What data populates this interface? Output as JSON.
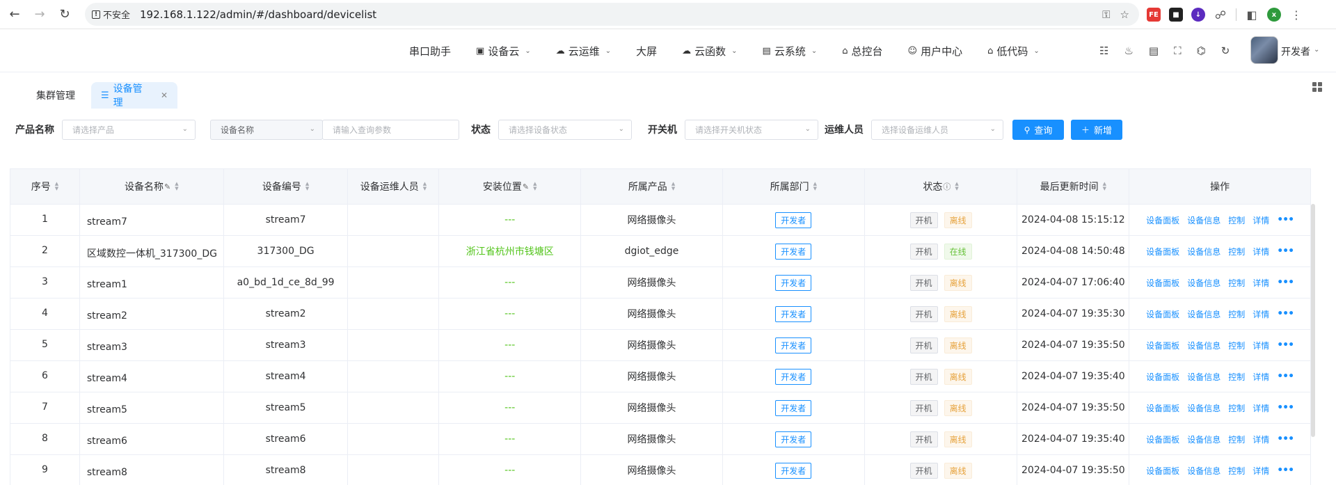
{
  "browser": {
    "insecure_label": "不安全",
    "url": "192.168.1.122/admin/#/dashboard/devicelist",
    "ext_fe_label": "FE",
    "profile_initial": "x"
  },
  "header": {
    "menu": [
      {
        "label": "串口助手",
        "icon": "",
        "caret": false
      },
      {
        "label": "设备云",
        "icon": "device-icon",
        "caret": true
      },
      {
        "label": "云运维",
        "icon": "cloud-icon",
        "caret": true
      },
      {
        "label": "大屏",
        "icon": "",
        "caret": false
      },
      {
        "label": "云函数",
        "icon": "cloud-function-icon",
        "caret": true
      },
      {
        "label": "云系统",
        "icon": "system-icon",
        "caret": true
      },
      {
        "label": "总控台",
        "icon": "home-icon",
        "caret": false
      },
      {
        "label": "用户中心",
        "icon": "user-icon",
        "caret": false
      },
      {
        "label": "低代码",
        "icon": "lowcode-icon",
        "caret": true
      }
    ],
    "user_name": "开发者"
  },
  "tabs": [
    {
      "label": "集群管理",
      "active": false
    },
    {
      "label": "设备管理",
      "active": true
    }
  ],
  "filters": {
    "product_label": "产品名称",
    "product_placeholder": "请选择产品",
    "name_field_select": "设备名称",
    "name_placeholder": "请输入查询参数",
    "status_label": "状态",
    "status_placeholder": "请选择设备状态",
    "power_label": "开关机",
    "power_placeholder": "请选择开关机状态",
    "ops_label": "运维人员",
    "ops_placeholder": "选择设备运维人员",
    "query_btn": "查询",
    "add_btn": "新增"
  },
  "table": {
    "headers": [
      "序号",
      "设备名称",
      "设备编号",
      "设备运维人员",
      "安装位置",
      "所属产品",
      "所属部门",
      "状态",
      "最后更新时间",
      "操作"
    ],
    "ops_labels": [
      "设备面板",
      "设备信息",
      "控制",
      "详情"
    ],
    "rows": [
      {
        "idx": "1",
        "name": "stream7",
        "code": "stream7",
        "ops": "",
        "loc": "---",
        "product": "网络摄像头",
        "dept": "开发者",
        "power": "开机",
        "status": "离线",
        "online": false,
        "time": "2024-04-08 15:15:12"
      },
      {
        "idx": "2",
        "name": "区域数控一体机_317300_DG",
        "code": "317300_DG",
        "ops": "",
        "loc": "浙江省杭州市钱塘区",
        "product": "dgiot_edge",
        "dept": "开发者",
        "power": "开机",
        "status": "在线",
        "online": true,
        "time": "2024-04-08 14:50:48"
      },
      {
        "idx": "3",
        "name": "stream1",
        "code": "a0_bd_1d_ce_8d_99",
        "ops": "",
        "loc": "---",
        "product": "网络摄像头",
        "dept": "开发者",
        "power": "开机",
        "status": "离线",
        "online": false,
        "time": "2024-04-07 17:06:40"
      },
      {
        "idx": "4",
        "name": "stream2",
        "code": "stream2",
        "ops": "",
        "loc": "---",
        "product": "网络摄像头",
        "dept": "开发者",
        "power": "开机",
        "status": "离线",
        "online": false,
        "time": "2024-04-07 19:35:30"
      },
      {
        "idx": "5",
        "name": "stream3",
        "code": "stream3",
        "ops": "",
        "loc": "---",
        "product": "网络摄像头",
        "dept": "开发者",
        "power": "开机",
        "status": "离线",
        "online": false,
        "time": "2024-04-07 19:35:50"
      },
      {
        "idx": "6",
        "name": "stream4",
        "code": "stream4",
        "ops": "",
        "loc": "---",
        "product": "网络摄像头",
        "dept": "开发者",
        "power": "开机",
        "status": "离线",
        "online": false,
        "time": "2024-04-07 19:35:40"
      },
      {
        "idx": "7",
        "name": "stream5",
        "code": "stream5",
        "ops": "",
        "loc": "---",
        "product": "网络摄像头",
        "dept": "开发者",
        "power": "开机",
        "status": "离线",
        "online": false,
        "time": "2024-04-07 19:35:50"
      },
      {
        "idx": "8",
        "name": "stream6",
        "code": "stream6",
        "ops": "",
        "loc": "---",
        "product": "网络摄像头",
        "dept": "开发者",
        "power": "开机",
        "status": "离线",
        "online": false,
        "time": "2024-04-07 19:35:40"
      },
      {
        "idx": "9",
        "name": "stream8",
        "code": "stream8",
        "ops": "",
        "loc": "---",
        "product": "网络摄像头",
        "dept": "开发者",
        "power": "开机",
        "status": "离线",
        "online": false,
        "time": "2024-04-07 19:35:50"
      }
    ]
  },
  "colors": {
    "primary": "#1890ff",
    "online": "#67c23a",
    "offline": "#e6a23c",
    "location": "#52c41a"
  }
}
